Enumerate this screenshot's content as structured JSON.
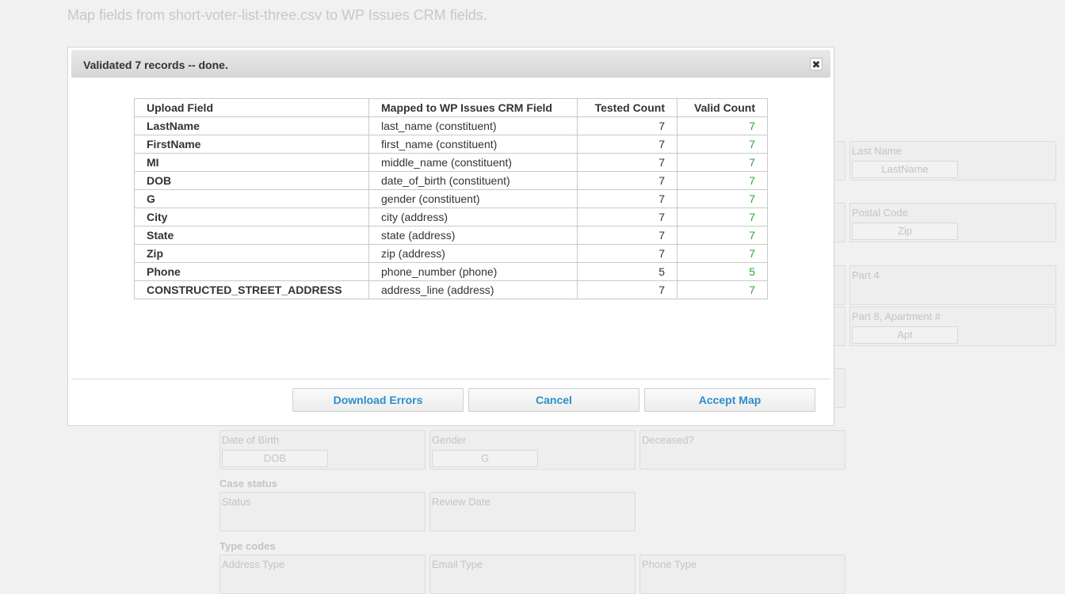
{
  "page": {
    "heading": "Map fields from short-voter-list-three.csv to WP Issues CRM fields."
  },
  "background": {
    "right_fields": [
      {
        "label": "Last Name",
        "value": "LastName"
      },
      {
        "label": "Postal Code",
        "value": "Zip"
      },
      {
        "label": "Part 4",
        "value": ""
      },
      {
        "label": "Part 8, Apartment #",
        "value": "Apt"
      }
    ],
    "row1": [
      {
        "label": "Date of Birth",
        "value": "DOB"
      },
      {
        "label": "Gender",
        "value": "G"
      },
      {
        "label": "Deceased?",
        "value": ""
      }
    ],
    "case_status": {
      "heading": "Case status",
      "fields": [
        {
          "label": "Status",
          "value": ""
        },
        {
          "label": "Review Date",
          "value": ""
        }
      ]
    },
    "type_codes": {
      "heading": "Type codes",
      "fields": [
        {
          "label": "Address Type",
          "value": ""
        },
        {
          "label": "Email Type",
          "value": ""
        },
        {
          "label": "Phone Type",
          "value": ""
        }
      ]
    }
  },
  "dialog": {
    "title": "Validated 7 records -- done.",
    "close_glyph": "✖",
    "table": {
      "headers": [
        "Upload Field",
        "Mapped to WP Issues CRM Field",
        "Tested Count",
        "Valid Count"
      ],
      "rows": [
        {
          "field": "LastName",
          "mapped": "last_name (constituent)",
          "tested": "7",
          "valid": "7"
        },
        {
          "field": "FirstName",
          "mapped": "first_name (constituent)",
          "tested": "7",
          "valid": "7"
        },
        {
          "field": "MI",
          "mapped": "middle_name (constituent)",
          "tested": "7",
          "valid": "7"
        },
        {
          "field": "DOB",
          "mapped": "date_of_birth (constituent)",
          "tested": "7",
          "valid": "7"
        },
        {
          "field": "G",
          "mapped": "gender (constituent)",
          "tested": "7",
          "valid": "7"
        },
        {
          "field": "City",
          "mapped": "city (address)",
          "tested": "7",
          "valid": "7"
        },
        {
          "field": "State",
          "mapped": "state (address)",
          "tested": "7",
          "valid": "7"
        },
        {
          "field": "Zip",
          "mapped": "zip (address)",
          "tested": "7",
          "valid": "7"
        },
        {
          "field": "Phone",
          "mapped": "phone_number (phone)",
          "tested": "5",
          "valid": "5"
        },
        {
          "field": "CONSTRUCTED_STREET_ADDRESS",
          "mapped": "address_line (address)",
          "tested": "7",
          "valid": "7"
        }
      ]
    },
    "buttons": {
      "download": "Download Errors",
      "cancel": "Cancel",
      "accept": "Accept Map"
    }
  },
  "colors": {
    "valid_count": "#2ea52e",
    "button_text": "#2b8fc9"
  }
}
